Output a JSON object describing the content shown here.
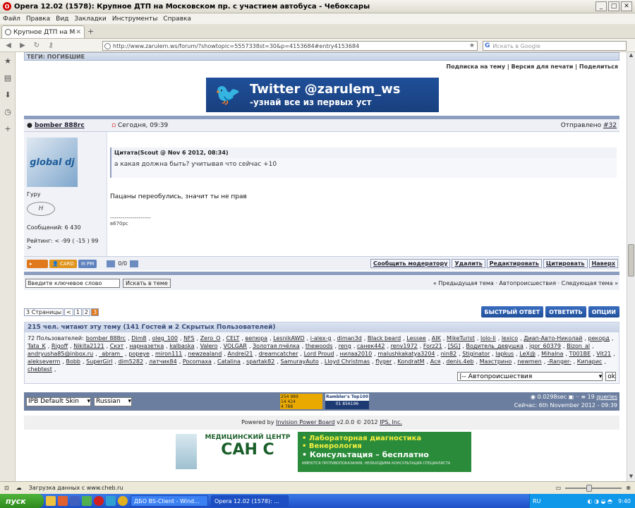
{
  "window": {
    "title": "Opera 12.02 (1578): Крупное ДТП на Московском пр. с участием автобуса - Чебоксары",
    "minimize": "_",
    "maximize": "□",
    "close": "✕"
  },
  "menu": [
    "Файл",
    "Правка",
    "Вид",
    "Закладки",
    "Инструменты",
    "Справка"
  ],
  "tab": {
    "label": "Крупное ДТП на Московско...",
    "close": "✕",
    "new": "+"
  },
  "nav": {
    "url": "http://www.zarulem.ws/forum/?showtopic=5557338st=30&p=4153684#entry4153684",
    "search_placeholder": "Искать в Google",
    "search_engine": "G"
  },
  "forum": {
    "section_header": "ТЕГИ: ПОГИБШИЕ",
    "tools": "Подписка на тему | Версия для печати | Поделиться",
    "twitter_line1": "Twitter @zarulem_ws",
    "twitter_line2": "-узнай все из первых уст",
    "post": {
      "author": "bomber 888rc",
      "time": "Сегодня, 09:39",
      "sent_label": "Отправлено",
      "post_num": "#32",
      "rank": "Гуру",
      "messages": "Сообщений: 6 430",
      "rating": "Рейтинг: < -99 ( -15 ) 99 >",
      "avatar_text": "global dj",
      "quote_header": "Цитата(Scout @ Nov 6 2012, 08:34)",
      "quote_text": "а какая должна быть? учитывая что сейчас +10",
      "text": "Пацаны переобулись, значит ты не прав",
      "sig_line": "--------------------",
      "sig": "в670рс",
      "btn_card": "CARD",
      "btn_pm": "PM",
      "votes": "0/0",
      "action_buttons": [
        "Сообщить модератору",
        "Удалить",
        "Редактировать",
        "Цитировать",
        "Наверх"
      ]
    },
    "search_value": "Введите ключевое слово",
    "search_button": "Искать в теме",
    "topic_nav": "« Предыдущая тема · Автопроисшествия · Следующая тема »",
    "pages_label": "3 Страницы",
    "pages": [
      "<",
      "1",
      "2",
      "3"
    ],
    "quick_reply": "БЫСТРЫЙ ОТВЕТ",
    "reply": "ОТВЕТИТЬ",
    "options": "ОПЦИИ",
    "readers_header": "215 чел. читают эту тему (141 Гостей и 2 Скрытых Пользователей)",
    "readers_prefix": "72 Пользователей:",
    "readers": [
      "bomber 888rc",
      "Dim8",
      "oleg_100",
      "NFS",
      "Zero_O",
      "CELT",
      "вепюра",
      "LesnikAWD",
      "i-alex-g",
      "diman3d",
      "Black beard",
      "Lessee",
      "AIK",
      "MikeTurist",
      "lolo-li",
      "lexico",
      "Диап-Авто-Николай",
      "рекорд",
      "Tata_K",
      "Rigoff",
      "Nikita2121",
      "Скэт",
      "нарназетка",
      "kalbaska",
      "Valero",
      "VOLGAR",
      "Золотая пчёлка",
      "thewoods",
      "reng",
      "санек442",
      "renv1972",
      "Forz21",
      "[SG]",
      "Водитель_девушка",
      "igor_60379",
      "Bizon_al",
      "andryusha85@inbox.ru",
      "_abram_",
      "popeye",
      "miron111",
      "newzealand",
      "Andrei21",
      "dreamcatcher",
      "Lord Proud",
      "нилаа2010",
      "malushkakatya3204",
      "nin82",
      "Stiginator",
      "lapkus",
      "LeX@",
      "Mihalna",
      "T001BE",
      "Vit21",
      "alekseverm",
      "Bobb",
      "SuperGirl",
      "dim5282",
      "латчик84",
      "Pocomaxa",
      "Catalina",
      "spartak82",
      "SamurayAuto",
      "Lloyd Christmas",
      "flyger",
      "KondratM",
      "Ася",
      "denis.4eb",
      "Маэстрино",
      "newmen",
      "-Ranger-",
      "Кипарис",
      "chebtest"
    ],
    "jump_select": "|-- Автопроисшествия",
    "jump_ok": "ok",
    "skin": "IPB Default Skin",
    "lang": "Russian",
    "counter1": "254 989\n14 424\n4 788",
    "counter2_top": "Rambler's Top100",
    "counter2_num": "01 856196",
    "exec_time": "0.0298sec",
    "queries_count": "19",
    "queries_label": "queries",
    "now": "Сейчас: 6th November 2012 - 09:39",
    "powered": "Powered by",
    "powered_link": "Invision Power Board",
    "powered_ver": "v2.0.0 © 2012",
    "ips": "IPS, Inc.",
    "ad_title": "МЕДИЦИНСКИЙ ЦЕНТР",
    "ad_brand": "САН С",
    "ad_lines": [
      "• Лабораторная диагностика",
      "• Венерология",
      "• Консультация – бесплатно"
    ],
    "ad_footer": "ИМЕЮТСЯ ПРОТИВОПОКАЗАНИЯ, НЕОБХОДИМА КОНСУЛЬТАЦИЯ СПЕЦИАЛИСТА"
  },
  "status": {
    "text": "Загрузка данных с www.cheb.ru"
  },
  "taskbar": {
    "start": "пуск",
    "task1": "ДБО BS-Client - Wind...",
    "task2": "Opera 12.02 (1578): ...",
    "lang": "RU",
    "clock": "9:40"
  }
}
